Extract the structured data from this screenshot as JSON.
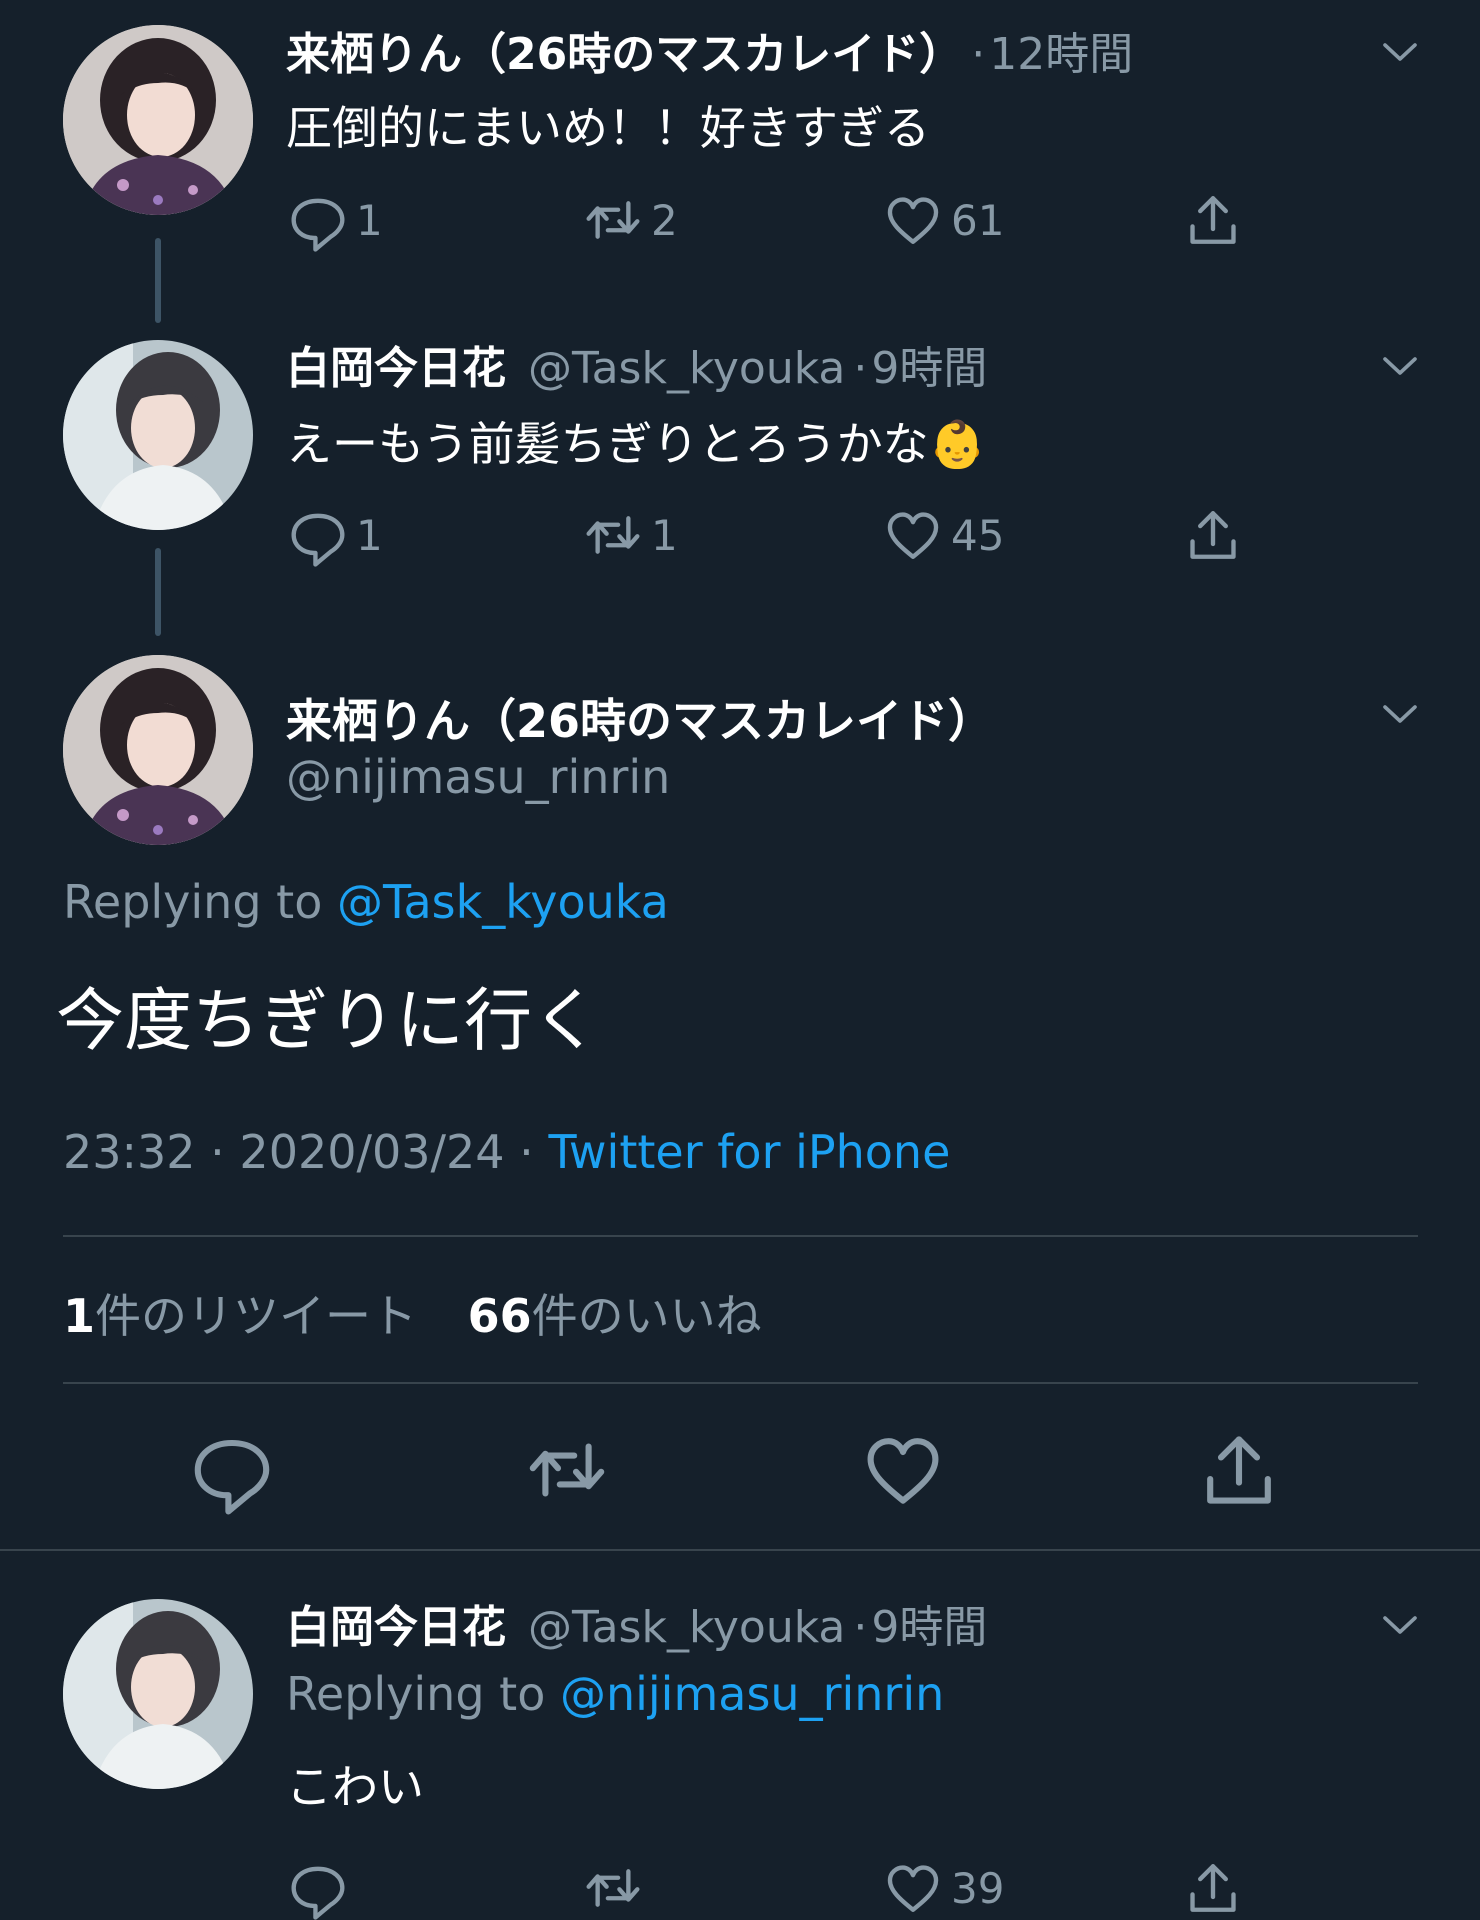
{
  "tweets": [
    {
      "name": "来栖りん（26時のマスカレイド）",
      "handle": "",
      "time": "12時間",
      "text": "圧倒的にまいめ！！好きすぎる",
      "replies": "1",
      "retweets": "2",
      "likes": "61"
    },
    {
      "name": "白岡今日花",
      "handle": "@Task_kyouka",
      "time": "9時間",
      "text": "えーもう前髪ちぎりとろうかな",
      "emoji": "👶",
      "replies": "1",
      "retweets": "1",
      "likes": "45"
    }
  ],
  "main_tweet": {
    "name": "来栖りん（26時のマスカレイド）",
    "handle": "@nijimasu_rinrin",
    "replying_prefix": "Replying to",
    "replying_to": "@Task_kyouka",
    "text": "今度ちぎりに行く",
    "timestamp": "23:32 · 2020/03/24 ·",
    "source": "Twitter for iPhone",
    "retweet_count": "1",
    "retweet_label": "件のリツイート",
    "like_count": "66",
    "like_label": "件のいいね"
  },
  "reply_tweet": {
    "name": "白岡今日花",
    "handle": "@Task_kyouka",
    "time": "9時間",
    "replying_prefix": "Replying to",
    "replying_to": "@nijimasu_rinrin",
    "text": "こわい",
    "replies": "",
    "retweets": "",
    "likes": "39"
  },
  "colors": {
    "background": "#15202b",
    "secondary_text": "#8899a6",
    "link": "#1da1f2",
    "divider": "#38444d"
  }
}
